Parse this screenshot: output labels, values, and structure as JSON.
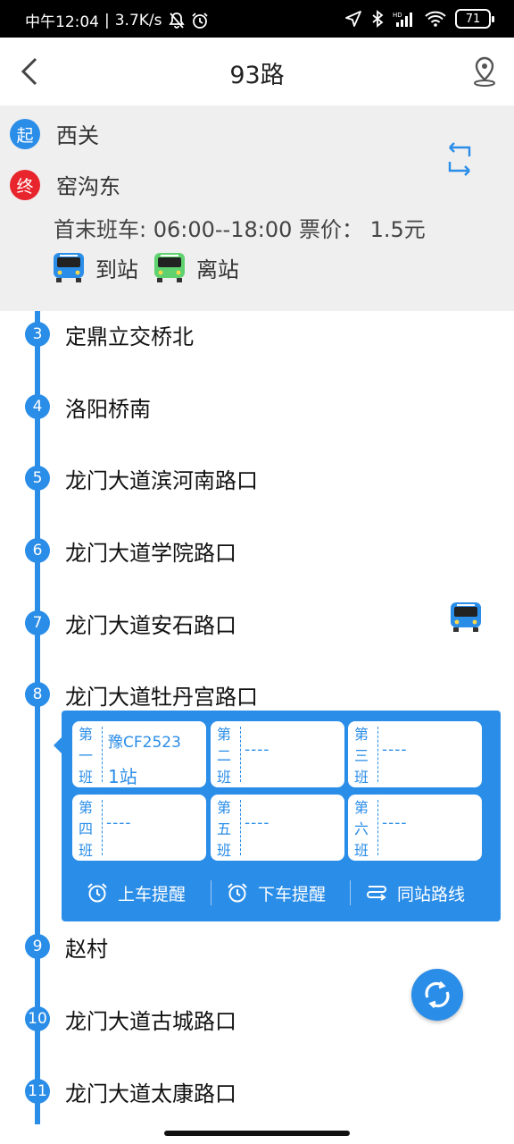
{
  "statusbar": {
    "time": "中午12:04",
    "sep": "|",
    "speed": "3.7K/s",
    "battery": "71",
    "icons": [
      "mute-bell-icon",
      "alarm-icon",
      "location-arrow-icon",
      "bluetooth-icon",
      "hd-signal-icon",
      "wifi-icon",
      "battery-icon"
    ]
  },
  "header": {
    "title": "93路",
    "icons": [
      "back-arrow-icon",
      "location-pin-icon"
    ]
  },
  "route": {
    "start_badge": "起",
    "start": "西关",
    "end_badge": "终",
    "end": "窑沟东",
    "schedule": "首末班车: 06:00--18:00 票价：  1.5元",
    "arriving_label": "到站",
    "leaving_label": "离站"
  },
  "stops": [
    {
      "num": "3",
      "name": "定鼎立交桥北"
    },
    {
      "num": "4",
      "name": "洛阳桥南"
    },
    {
      "num": "5",
      "name": "龙门大道滨河南路口"
    },
    {
      "num": "6",
      "name": "龙门大道学院路口"
    },
    {
      "num": "7",
      "name": "龙门大道安石路口"
    },
    {
      "num": "8",
      "name": "龙门大道牡丹宫路口"
    },
    {
      "num": "9",
      "name": "赵村"
    },
    {
      "num": "10",
      "name": "龙门大道古城路口"
    },
    {
      "num": "11",
      "name": "龙门大道太康路口"
    }
  ],
  "buses": [
    {
      "label": "第一班",
      "plate": "豫CF2523",
      "distance": "1站"
    },
    {
      "label": "第二班",
      "value": "----"
    },
    {
      "label": "第三班",
      "value": "----"
    },
    {
      "label": "第四班",
      "value": "----"
    },
    {
      "label": "第五班",
      "value": "----"
    },
    {
      "label": "第六班",
      "value": "----"
    }
  ],
  "actions": {
    "board_reminder": "上车提醒",
    "alight_reminder": "下车提醒",
    "same_stop_routes": "同站路线"
  },
  "colors": {
    "primary": "#2a8de8",
    "start_badge": "#2a8de8",
    "end_badge": "#e8242c",
    "arriving_bus": "#2a8de8",
    "leaving_bus": "#5fd16f",
    "info_bg": "#efefef"
  }
}
